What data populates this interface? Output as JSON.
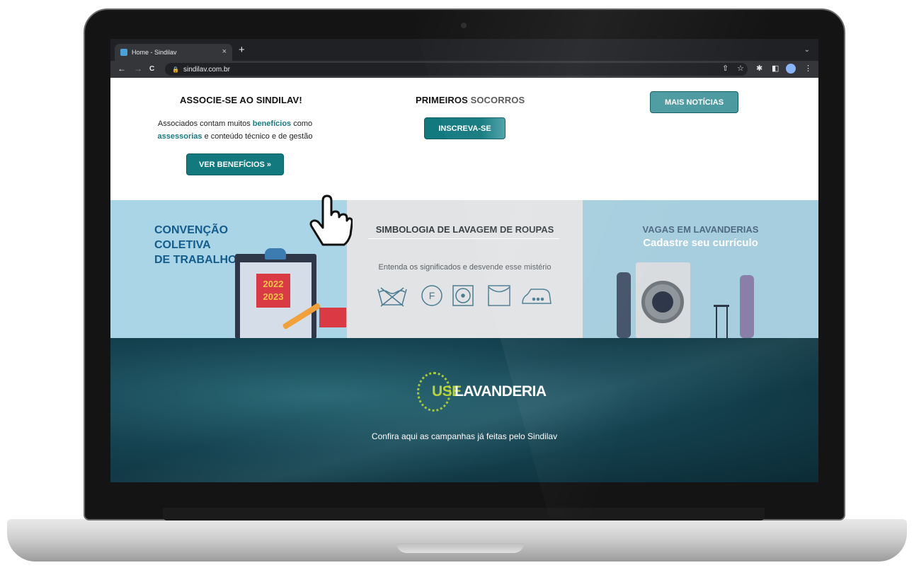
{
  "browser": {
    "tab_title": "Home - Sindilav",
    "tab_close": "×",
    "new_tab": "+",
    "tab_menu": "⌄",
    "url": "sindilav.com.br",
    "nav": {
      "back": "←",
      "forward": "→",
      "reload": "C"
    },
    "toolbar_icons": {
      "share": "⇧",
      "star": "☆",
      "extensions": "✱",
      "sidepanel": "◧",
      "menu": "⋮"
    }
  },
  "associe": {
    "title": "ASSOCIE-SE AO SINDILAV!",
    "line1_pre": "Associados contam muitos ",
    "line1_highlight": "benefícios",
    "line1_post": " como",
    "line2_highlight": "assessorias",
    "line2_post": " e conteúdo técnico e de gestão",
    "button": "VER BENEFÍCIOS »"
  },
  "socorros": {
    "title_bold": "PRIMEIROS",
    "title_rest": " SOCORROS",
    "button": "INSCREVA-SE"
  },
  "noticias": {
    "button": "MAIS NOTÍCIAS"
  },
  "banners": {
    "convencao": {
      "line1": "CONVENÇÃO",
      "line2": "COLETIVA",
      "line3": "DE TRABALHO",
      "year1": "2022",
      "year2": "2023"
    },
    "simbologia": {
      "title": "SIMBOLOGIA DE LAVAGEM DE ROUPAS",
      "subtitle": "Entenda os significados e desvende esse mistério",
      "symbol_f": "F"
    },
    "vagas": {
      "title": "VAGAS EM LAVANDERIAS",
      "subtitle": "Cadastre seu currículo"
    }
  },
  "campaign": {
    "logo_use": "USE",
    "logo_lav": "LAVANDERIA",
    "text": "Confira aqui as campanhas já feitas pelo Sindilav"
  },
  "colors": {
    "accent_teal": "#12797f",
    "highlight_text": "#1a7a82",
    "logo_green": "#b6d43a"
  }
}
